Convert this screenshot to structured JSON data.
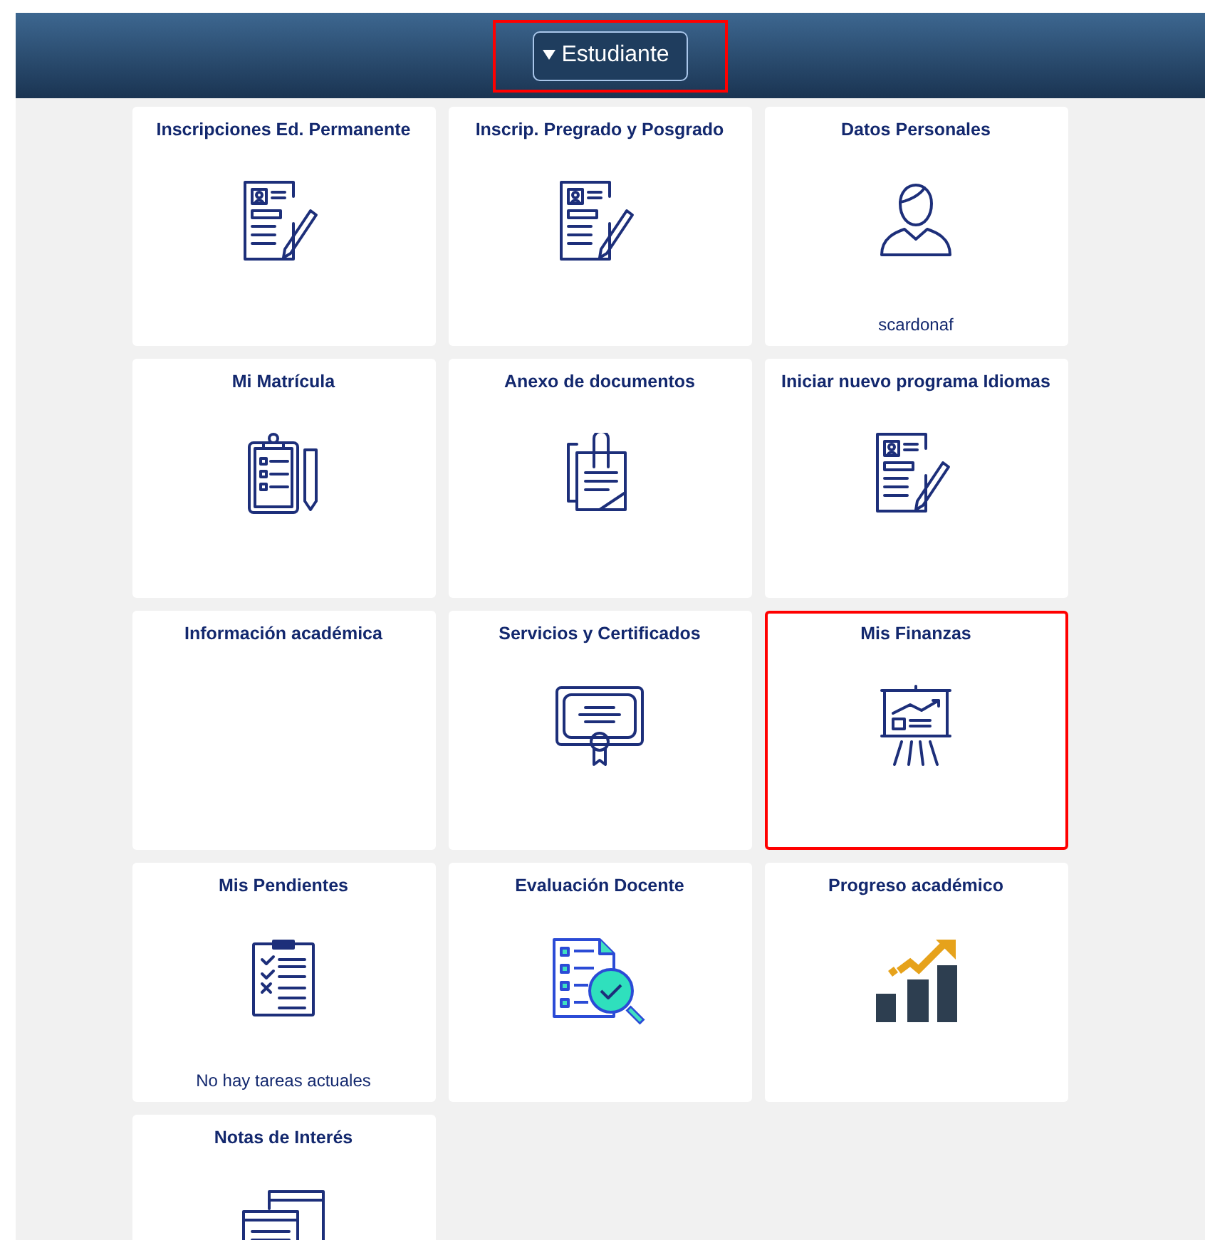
{
  "header": {
    "menu_button": {
      "label": "Estudiante",
      "highlighted": true
    }
  },
  "tiles": [
    {
      "title": "Inscripciones Ed. Permanente",
      "kind": "form",
      "highlighted": false
    },
    {
      "title": "Inscrip. Pregrado y Posgrado",
      "kind": "form",
      "highlighted": false
    },
    {
      "title": "Datos Personales",
      "kind": "person",
      "footer": "scardonaf",
      "highlighted": false
    },
    {
      "title": "Mi Matrícula",
      "kind": "clipboard",
      "highlighted": false
    },
    {
      "title": "Anexo de documentos",
      "kind": "documents",
      "highlighted": false
    },
    {
      "title": "Iniciar nuevo programa Idiomas",
      "kind": "form",
      "highlighted": false
    },
    {
      "title": "Información académica",
      "kind": "plain",
      "highlighted": false
    },
    {
      "title": "Servicios y Certificados",
      "kind": "certificate",
      "highlighted": false
    },
    {
      "title": "Mis Finanzas",
      "kind": "presentation",
      "highlighted": true
    },
    {
      "title": "Mis Pendientes",
      "kind": "checklist",
      "footer": "No hay tareas actuales",
      "highlighted": false
    },
    {
      "title": "Evaluación Docente",
      "kind": "evaluation",
      "highlighted": false
    },
    {
      "title": "Progreso académico",
      "kind": "growth",
      "highlighted": false
    },
    {
      "title": "Notas de Interés",
      "kind": "notes",
      "highlighted": false
    }
  ]
}
